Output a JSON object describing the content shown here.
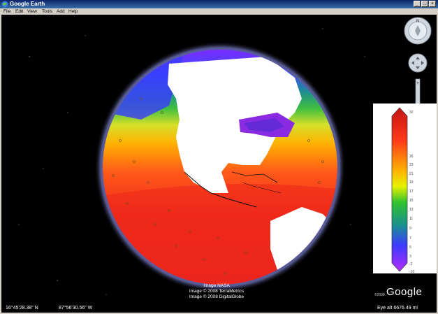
{
  "window": {
    "title": "Google Earth"
  },
  "menu": [
    {
      "label": "File"
    },
    {
      "label": "Edit"
    },
    {
      "label": "View"
    },
    {
      "label": "Tools"
    },
    {
      "label": "Add"
    },
    {
      "label": "Help"
    }
  ],
  "attribution": {
    "line1": "Image NASA",
    "line2": "Image © 2008 TerraMetrics",
    "line3": "Image © 2008 DigitalGlobe"
  },
  "status": {
    "coordinates_lat": "16°45'28.38\" N",
    "coordinates_lon": "87°56'30.56\" W",
    "eye_alt": "Eye alt  6676.49 mi"
  },
  "branding": {
    "logo": "Google",
    "copyright": "©2008"
  },
  "legend": {
    "labels": [
      "32",
      "26",
      "23",
      "21",
      "19",
      "17",
      "15",
      "13",
      "11",
      "9",
      "7",
      "5",
      "3",
      "-2",
      "-10"
    ]
  },
  "colors": {
    "titlebar": "#0a246a",
    "window_chrome": "#d4d0c8",
    "space": "#000000",
    "land": "#ffffff"
  },
  "icons": {
    "compass": "compass-icon",
    "look": "look-joystick-icon",
    "zoom": "zoom-slider-icon"
  }
}
